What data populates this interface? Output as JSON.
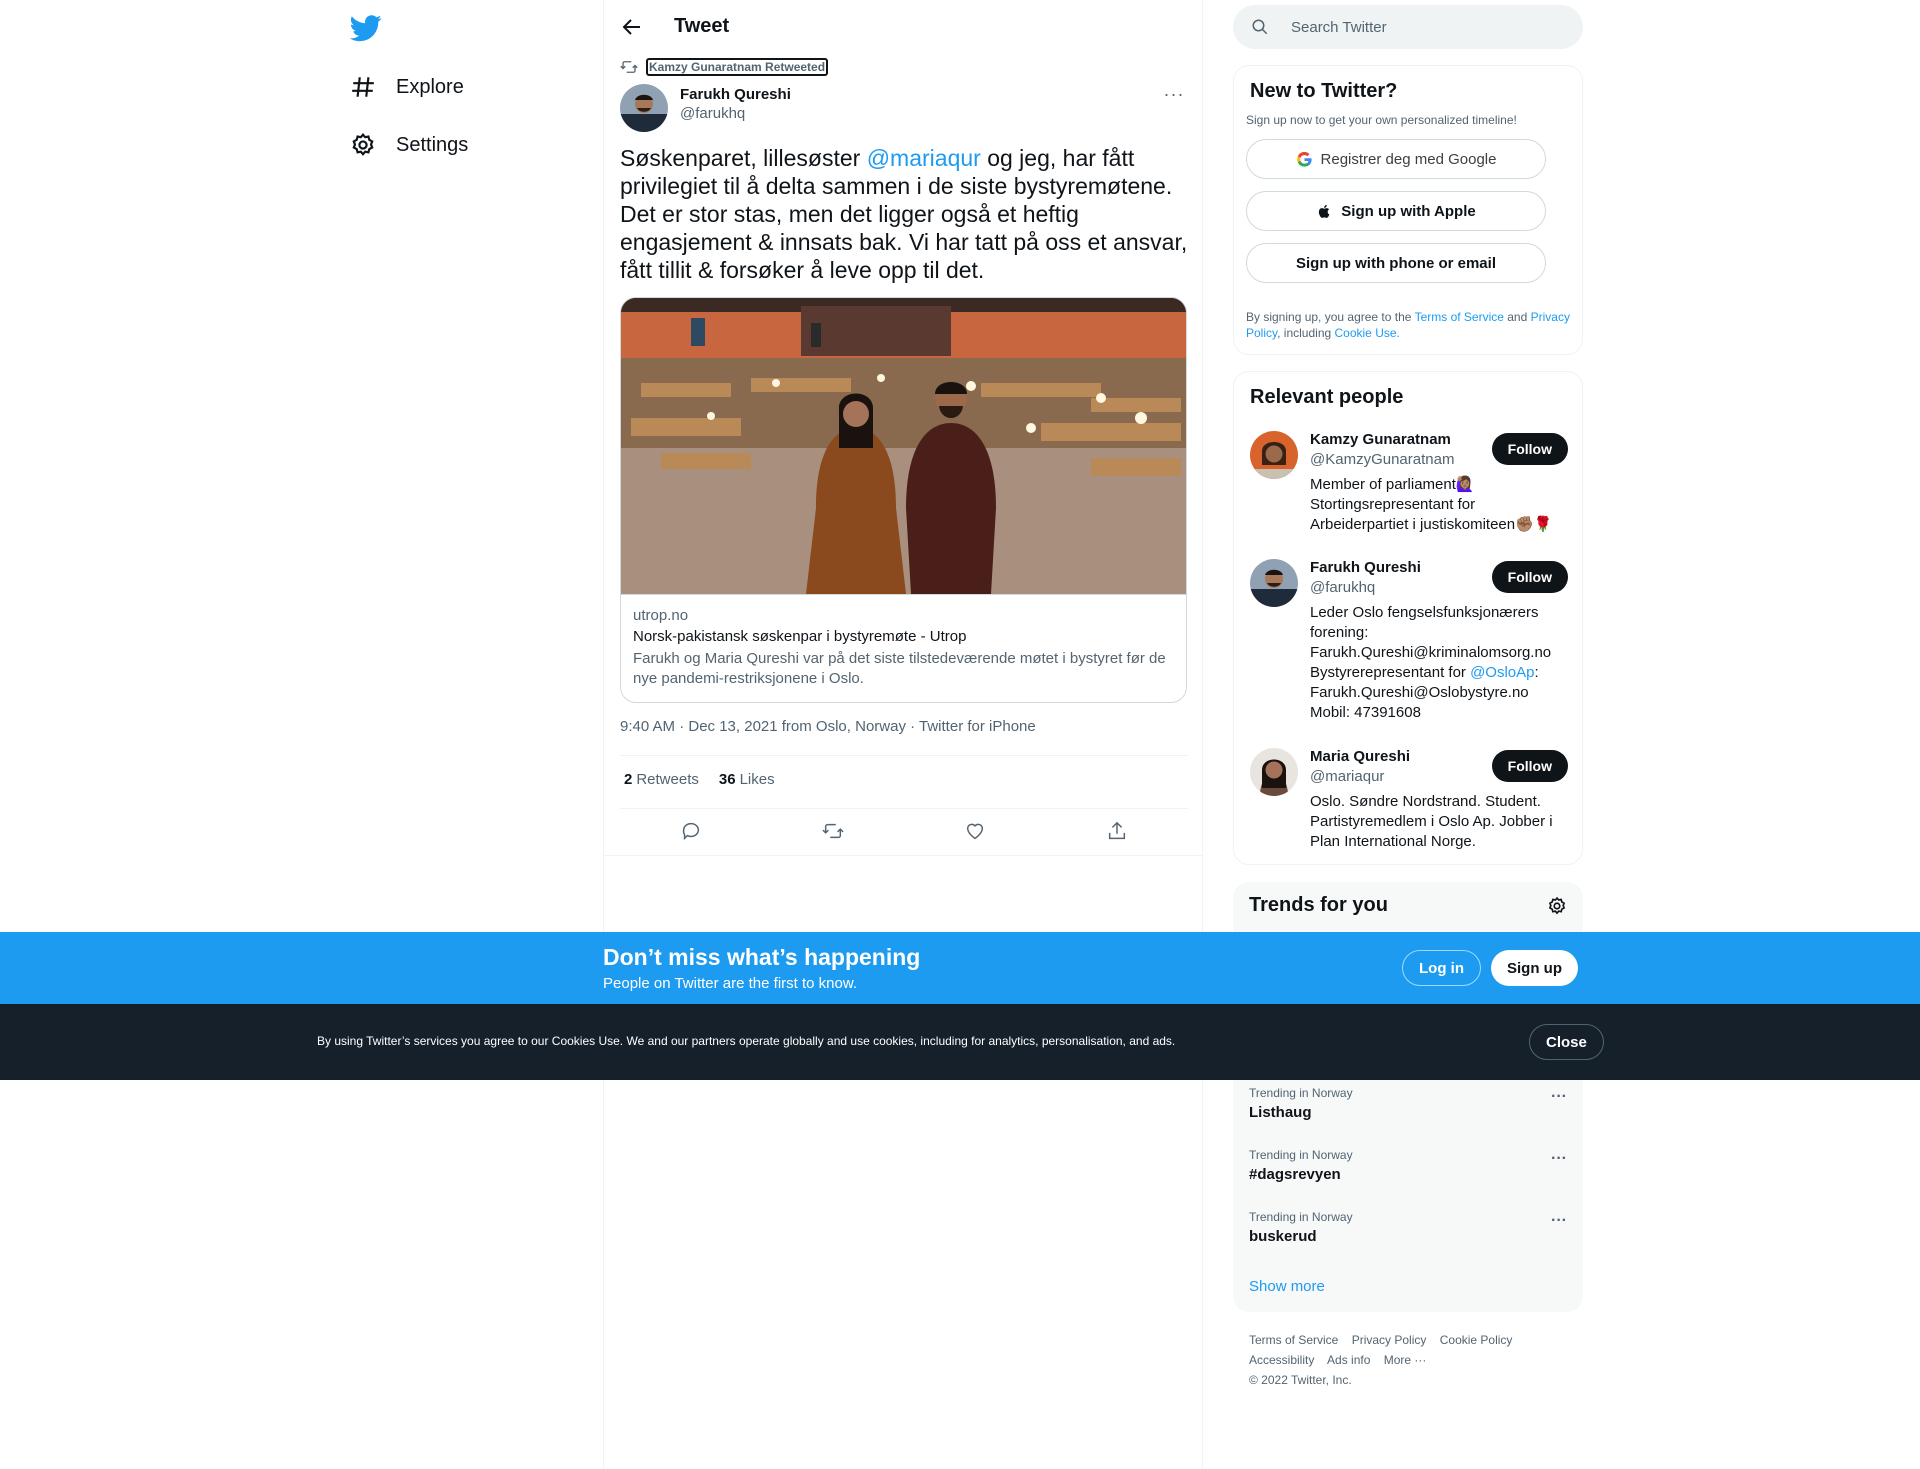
{
  "nav": {
    "items": [
      {
        "label": "Explore",
        "icon": "hashtag-icon"
      },
      {
        "label": "Settings",
        "icon": "gear-icon"
      }
    ]
  },
  "header": {
    "title": "Tweet"
  },
  "tweet": {
    "retweeted_by": "Kamzy Gunaratnam Retweeted",
    "author_name": "Farukh Qureshi",
    "author_handle": "@farukhq",
    "text_before": "Søskenparet, lillesøster ",
    "mention": "@mariaqur",
    "text_after": " og jeg, har fått privilegiet til å delta sammen i de siste bystyremøtene. Det er stor stas, men det ligger også et heftig engasjement & innsats bak. Vi har tatt på oss et ansvar, fått tillit & forsøker å leve opp til det.",
    "card": {
      "domain": "utrop.no",
      "title": "Norsk-pakistansk søskenpar i bystyremøte - Utrop",
      "description": "Farukh og Maria Qureshi var på det siste tilstedeværende møtet i bystyret før de nye pandemi-restriksjonene i Oslo."
    },
    "meta": "9:40 AM · Dec 13, 2021 from Oslo, Norway · Twitter for iPhone",
    "retweets_count": "2",
    "retweets_label": "Retweets",
    "likes_count": "36",
    "likes_label": "Likes"
  },
  "search": {
    "placeholder": "Search Twitter"
  },
  "new_to_twitter": {
    "title": "New to Twitter?",
    "subtitle": "Sign up now to get your own personalized timeline!",
    "google": "Registrer deg med Google",
    "apple": "Sign up with Apple",
    "phone": "Sign up with phone or email",
    "terms_prefix": "By signing up, you agree to the ",
    "terms_link": "Terms of Service",
    "terms_and": " and ",
    "privacy_link": "Privacy Policy",
    "terms_including": ", including ",
    "cookie_link": "Cookie Use."
  },
  "relevant_people": {
    "title": "Relevant people",
    "follow_label": "Follow",
    "people": [
      {
        "name": "Kamzy Gunaratnam",
        "handle": "@KamzyGunaratnam",
        "bio": "Member of parliament🙋🏽‍♀️ Stortingsrepresentant for Arbeiderpartiet i justiskomiteen✊🏽🌹"
      },
      {
        "name": "Farukh Qureshi",
        "handle": "@farukhq",
        "bio_before": "Leder Oslo fengselsfunksjonærers forening: Farukh.Qureshi@kriminalomsorg.no Bystyrerepresentant for ",
        "bio_mention": "@OsloAp",
        "bio_after": ": Farukh.Qureshi@Oslobystyre.no Mobil: 47391608"
      },
      {
        "name": "Maria Qureshi",
        "handle": "@mariaqur",
        "bio": "Oslo. Søndre Nordstrand. Student. Partistyremedlem i Oslo Ap. Jobber i Plan International Norge."
      }
    ]
  },
  "trends": {
    "title": "Trends for you",
    "items": [
      {
        "context": "Trending in Norway",
        "name": "Listhaug"
      },
      {
        "context": "Trending in Norway",
        "name": "#dagsrevyen"
      },
      {
        "context": "Trending in Norway",
        "name": "buskerud"
      }
    ],
    "show_more": "Show more"
  },
  "footer": {
    "links": [
      "Terms of Service",
      "Privacy Policy",
      "Cookie Policy",
      "Accessibility",
      "Ads info",
      "More ···"
    ],
    "copyright": "© 2022 Twitter, Inc."
  },
  "banner": {
    "title": "Don’t miss what’s happening",
    "subtitle": "People on Twitter are the first to know.",
    "login": "Log in",
    "signup": "Sign up"
  },
  "cookie": {
    "text": "By using Twitter’s services you agree to our Cookies Use. We and our partners operate globally and use cookies, including for analytics, personalisation, and ads.",
    "close": "Close"
  },
  "colors": {
    "accent": "#1d9bf0",
    "dark": "#0f1419",
    "muted": "#536471",
    "cookie_bg": "#15202b"
  }
}
